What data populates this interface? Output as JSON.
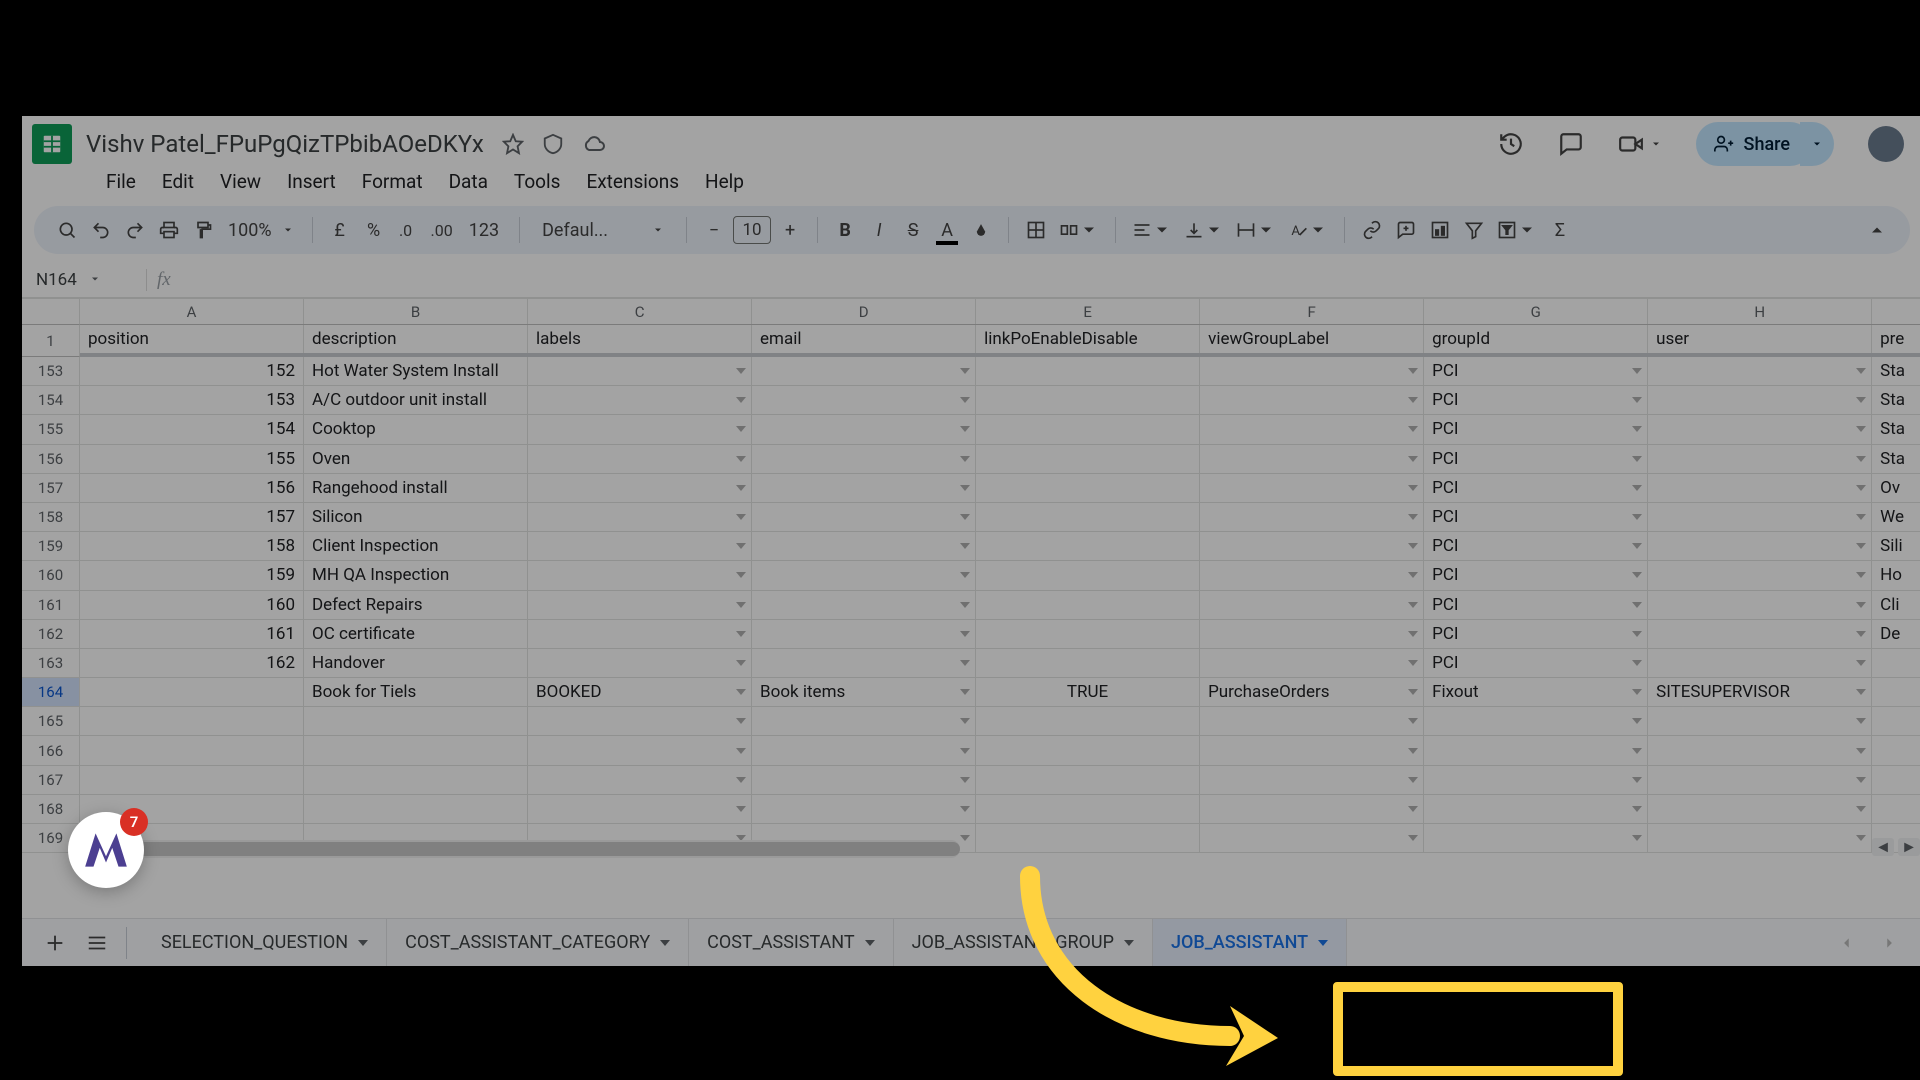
{
  "doc": {
    "title": "Vishv Patel_FPuPgQizTPbibAOeDKYx"
  },
  "menu": {
    "file": "File",
    "edit": "Edit",
    "view": "View",
    "insert": "Insert",
    "format": "Format",
    "data": "Data",
    "tools": "Tools",
    "extensions": "Extensions",
    "help": "Help"
  },
  "toolbar": {
    "zoom": "100%",
    "font": "Defaul...",
    "font_size": "10",
    "share": "Share"
  },
  "formula": {
    "name_box": "N164"
  },
  "columns": {
    "A": "A",
    "B": "B",
    "C": "C",
    "D": "D",
    "E": "E",
    "F": "F",
    "G": "G",
    "H": "H"
  },
  "headers": {
    "position": "position",
    "description": "description",
    "labels": "labels",
    "email": "email",
    "linkPo": "linkPoEnableDisable",
    "viewGroup": "viewGroupLabel",
    "groupId": "groupId",
    "user": "user",
    "i": "pre"
  },
  "row_head": {
    "top": "1",
    "r0": "153",
    "r1": "154",
    "r2": "155",
    "r3": "156",
    "r4": "157",
    "r5": "158",
    "r6": "159",
    "r7": "160",
    "r8": "161",
    "r9": "162",
    "r10": "163",
    "r11": "164",
    "r12": "165",
    "r13": "166",
    "r14": "167",
    "r15": "168",
    "r16": "169"
  },
  "rows": {
    "0": {
      "pos": "152",
      "desc": "Hot Water System Install",
      "group": "PCI",
      "i": "Sta"
    },
    "1": {
      "pos": "153",
      "desc": "A/C outdoor unit install",
      "group": "PCI",
      "i": "Sta"
    },
    "2": {
      "pos": "154",
      "desc": "Cooktop",
      "group": "PCI",
      "i": "Sta"
    },
    "3": {
      "pos": "155",
      "desc": "Oven",
      "group": "PCI",
      "i": "Sta"
    },
    "4": {
      "pos": "156",
      "desc": "Rangehood install",
      "group": "PCI",
      "i": "Ov"
    },
    "5": {
      "pos": "157",
      "desc": "Silicon",
      "group": "PCI",
      "i": "We"
    },
    "6": {
      "pos": "158",
      "desc": "Client Inspection",
      "group": "PCI",
      "i": "Sili"
    },
    "7": {
      "pos": "159",
      "desc": "MH QA Inspection",
      "group": "PCI",
      "i": "Ho"
    },
    "8": {
      "pos": "160",
      "desc": "Defect Repairs",
      "group": "PCI",
      "i": "Cli"
    },
    "9": {
      "pos": "161",
      "desc": "OC certificate",
      "group": "PCI",
      "i": "De"
    },
    "10": {
      "pos": "162",
      "desc": "Handover",
      "group": "PCI",
      "i": ""
    },
    "11": {
      "pos": "",
      "desc": "Book for Tiels",
      "labels": "BOOKED",
      "email": "Book items",
      "linkPo": "TRUE",
      "viewGroup": "PurchaseOrders",
      "group": "Fixout",
      "user": "SITESUPERVISOR",
      "i": ""
    }
  },
  "tabs": {
    "t0": "SELECTION_QUESTION",
    "t1": "COST_ASSISTANT_CATEGORY",
    "t2": "COST_ASSISTANT",
    "t3": "JOB_ASSISTANT_GROUP",
    "t4": "JOB_ASSISTANT"
  },
  "ext": {
    "badge": "7"
  }
}
